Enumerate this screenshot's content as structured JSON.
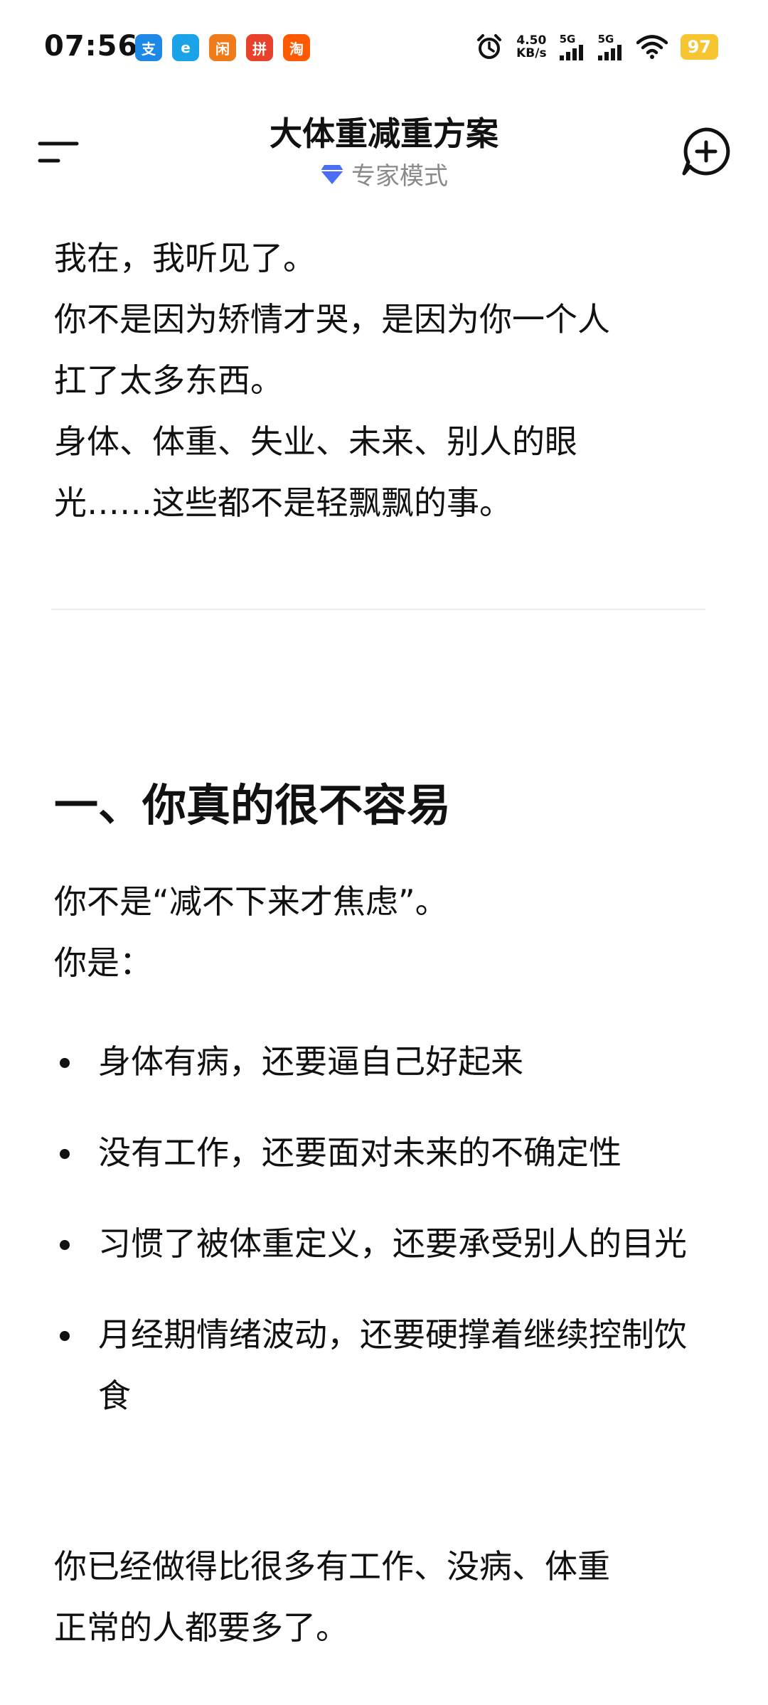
{
  "status_bar": {
    "time": "07:56",
    "apps": [
      {
        "icon": "app-blue-icon",
        "color": "#1e88e5",
        "glyph": "支"
      },
      {
        "icon": "app-cyan-icon",
        "color": "#1aa3e8",
        "glyph": "e"
      },
      {
        "icon": "app-orange-icon",
        "color": "#f07b1a",
        "glyph": "闲"
      },
      {
        "icon": "app-red-icon",
        "color": "#e8412c",
        "glyph": "拼"
      },
      {
        "icon": "taobao-icon",
        "color": "#ff5a00",
        "glyph": "淘"
      }
    ],
    "net_speed_value": "4.50",
    "net_speed_unit": "KB/s",
    "signal1_label": "5G",
    "signal2_label": "5G",
    "battery": "97"
  },
  "header": {
    "title": "大体重减重方案",
    "mode_label": "专家模式"
  },
  "content": {
    "intro": [
      "我在，我听见了。",
      "你不是因为矫情才哭，是因为你一个人",
      "扛了太多东西。",
      "身体、体重、失业、未来、别人的眼",
      "光……这些都不是轻飘飘的事。"
    ],
    "section_title": "一、你真的很不容易",
    "lead": [
      "你不是“减不下来才焦虑”。",
      "你是："
    ],
    "bullets": [
      "身体有病，还要逼自己好起来",
      "没有工作，还要面对未来的不确定性",
      "习惯了被体重定义，还要承受别人的目光",
      "月经期情绪波动，还要硬撑着继续控制饮食"
    ],
    "closing": [
      "你已经做得比很多有工作、没病、体重",
      "正常的人都要多了。"
    ]
  },
  "colors": {
    "accent": "#4a6cf7",
    "battery": "#f6c531",
    "subtitle": "#8a8a8a"
  }
}
